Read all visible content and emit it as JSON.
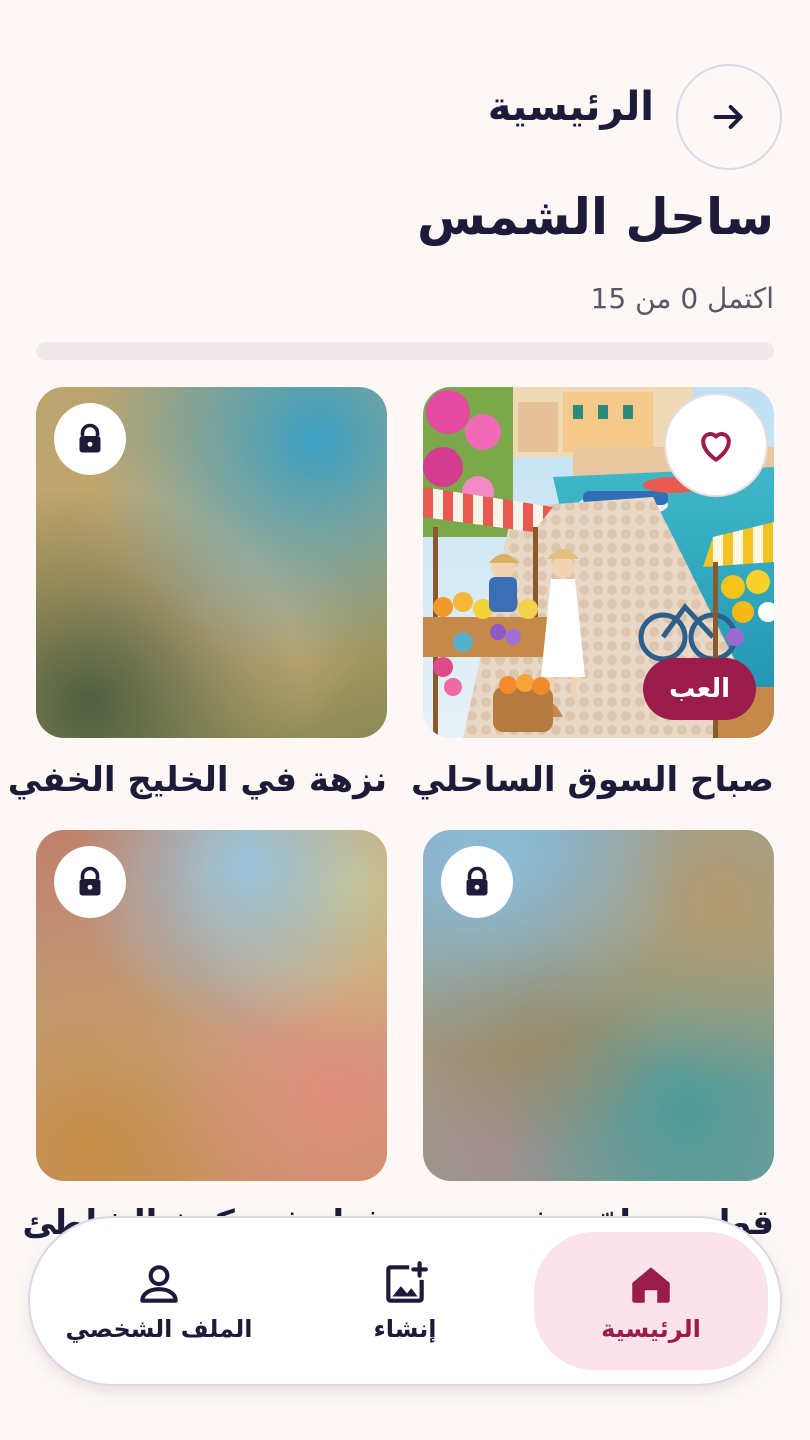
{
  "header": {
    "back_icon": "arrow-right-icon",
    "breadcrumb": "الرئيسية"
  },
  "collection": {
    "title": "ساحل الشمس",
    "progress_text": "اكتمل 0 من 15",
    "progress_completed": 0,
    "progress_total": 15
  },
  "cards": [
    {
      "title": "صباح السوق الساحلي",
      "locked": false,
      "favorite_icon": "heart-icon",
      "action_label": "العب"
    },
    {
      "title": "نزهة في الخليج الخفي",
      "locked": true,
      "lock_icon": "lock-icon"
    },
    {
      "title": "قوارب ملوّنة في...",
      "locked": true,
      "lock_icon": "lock-icon"
    },
    {
      "title": "غداء في كوخ الشاطئ",
      "locked": true,
      "lock_icon": "lock-icon"
    }
  ],
  "bottom_nav": {
    "items": [
      {
        "label": "الرئيسية",
        "icon": "home-icon",
        "active": true
      },
      {
        "label": "إنشاء",
        "icon": "add-image-icon",
        "active": false
      },
      {
        "label": "الملف الشخصي",
        "icon": "user-icon",
        "active": false
      }
    ]
  },
  "colors": {
    "accent": "#9b1b4a",
    "accent_soft": "#fae3ea",
    "background": "#fdf8f5",
    "text": "#1e1b3a"
  }
}
